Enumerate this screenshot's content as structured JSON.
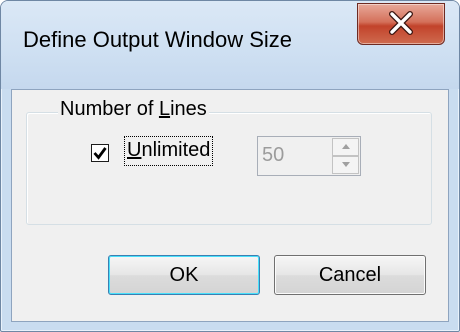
{
  "window": {
    "title": "Define Output Window Size",
    "close_label": "X"
  },
  "groupbox": {
    "legend_prefix": "Number of ",
    "legend_accel": "L",
    "legend_suffix": "ines"
  },
  "unlimited": {
    "checked": true,
    "label_accel": "U",
    "label_rest": "nlimited"
  },
  "line_count": {
    "value": "50",
    "disabled": true
  },
  "buttons": {
    "ok_label": "OK",
    "cancel_label": "Cancel"
  }
}
